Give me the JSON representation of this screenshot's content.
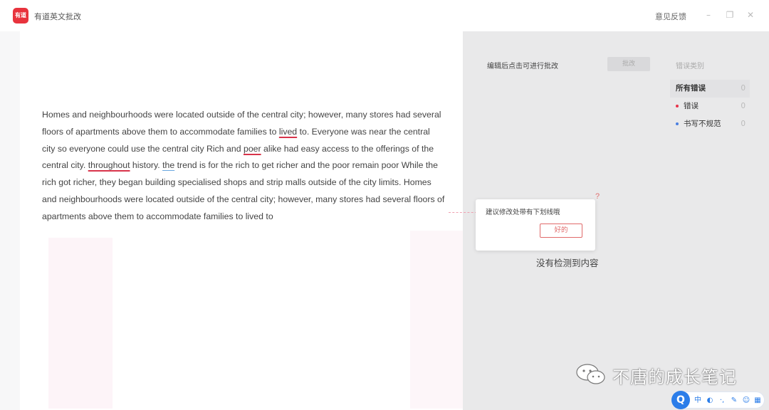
{
  "app": {
    "logo_text": "有道",
    "title": "有道英文批改",
    "feedback_label": "意见反馈",
    "controls": [
      "minimize-icon",
      "restore-icon",
      "close-icon"
    ]
  },
  "essay": {
    "segments": [
      {
        "text": "Homes and neighbourhoods were located outside of the central city; however, many stores had several floors of apartments above them to accommodate families to ",
        "mark": null
      },
      {
        "text": "lived",
        "mark": "error"
      },
      {
        "text": " to. Everyone was near the central city so everyone could use the central city Rich and ",
        "mark": null
      },
      {
        "text": "poer",
        "mark": "error"
      },
      {
        "text": " alike had easy access to the offerings of the central city. ",
        "mark": null
      },
      {
        "text": "throughout",
        "mark": "error"
      },
      {
        "text": " history. ",
        "mark": null
      },
      {
        "text": "the",
        "mark": "warning"
      },
      {
        "text": " trend is for the rich to get richer and the poor remain poor While the rich got richer, they began building specialised shops and strip malls outside of the city limits. Homes and neighbourhoods were located outside of the central city; however, many stores had several floors of apartments above them to accommodate families to lived to",
        "mark": null
      }
    ]
  },
  "panel": {
    "hint": "编辑后点击可进行批改",
    "correct_button": "批改",
    "filter_title": "错误类别",
    "filters": [
      {
        "label": "所有错误",
        "count": "0",
        "dot": null
      },
      {
        "label": "错误",
        "count": "0",
        "dot": "#e8334a"
      },
      {
        "label": "书写不规范",
        "count": "0",
        "dot": "#4a7fe0"
      }
    ],
    "empty_text": "没有检测到内容"
  },
  "tooltip": {
    "text": "建议修改处带有下划线哦",
    "button": "好的"
  },
  "watermark": {
    "text": "不唐的成长笔记"
  },
  "ime": {
    "logo": "Q",
    "items": [
      "中",
      "moon-icon",
      "punctuation-icon",
      "wrench-icon",
      "emoji-icon",
      "grid-icon"
    ]
  },
  "colors": {
    "accent": "#e8333d",
    "error_underline": "#d8344a",
    "warning_underline": "#6aa7e0",
    "panel_bg": "#e9e9ea"
  }
}
